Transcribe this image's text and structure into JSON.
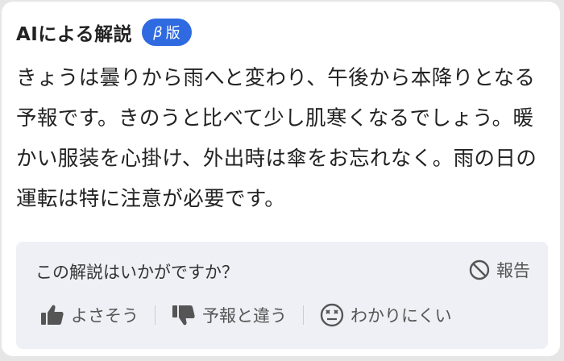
{
  "header": {
    "title": "AIによる解説",
    "badge_beta": "β",
    "badge_label": "版"
  },
  "commentary": {
    "text": "きょうは曇りから雨へと変わり、午後から本降りとなる予報です。きのうと比べて少し肌寒くなるでしょう。暖かい服装を心掛け、外出時は傘をお忘れなく。雨の日の運転は特に注意が必要です。"
  },
  "feedback": {
    "question": "この解説はいかがですか？",
    "report_label": "報告",
    "options": [
      {
        "label": "よさそう",
        "icon": "thumbs-up-icon"
      },
      {
        "label": "予報と違う",
        "icon": "thumbs-down-icon"
      },
      {
        "label": "わかりにくい",
        "icon": "confused-face-icon"
      }
    ]
  },
  "colors": {
    "badge_bg": "#2f6ae0",
    "feedback_bg": "#eef0f5",
    "text": "#222222",
    "muted": "#555555"
  }
}
